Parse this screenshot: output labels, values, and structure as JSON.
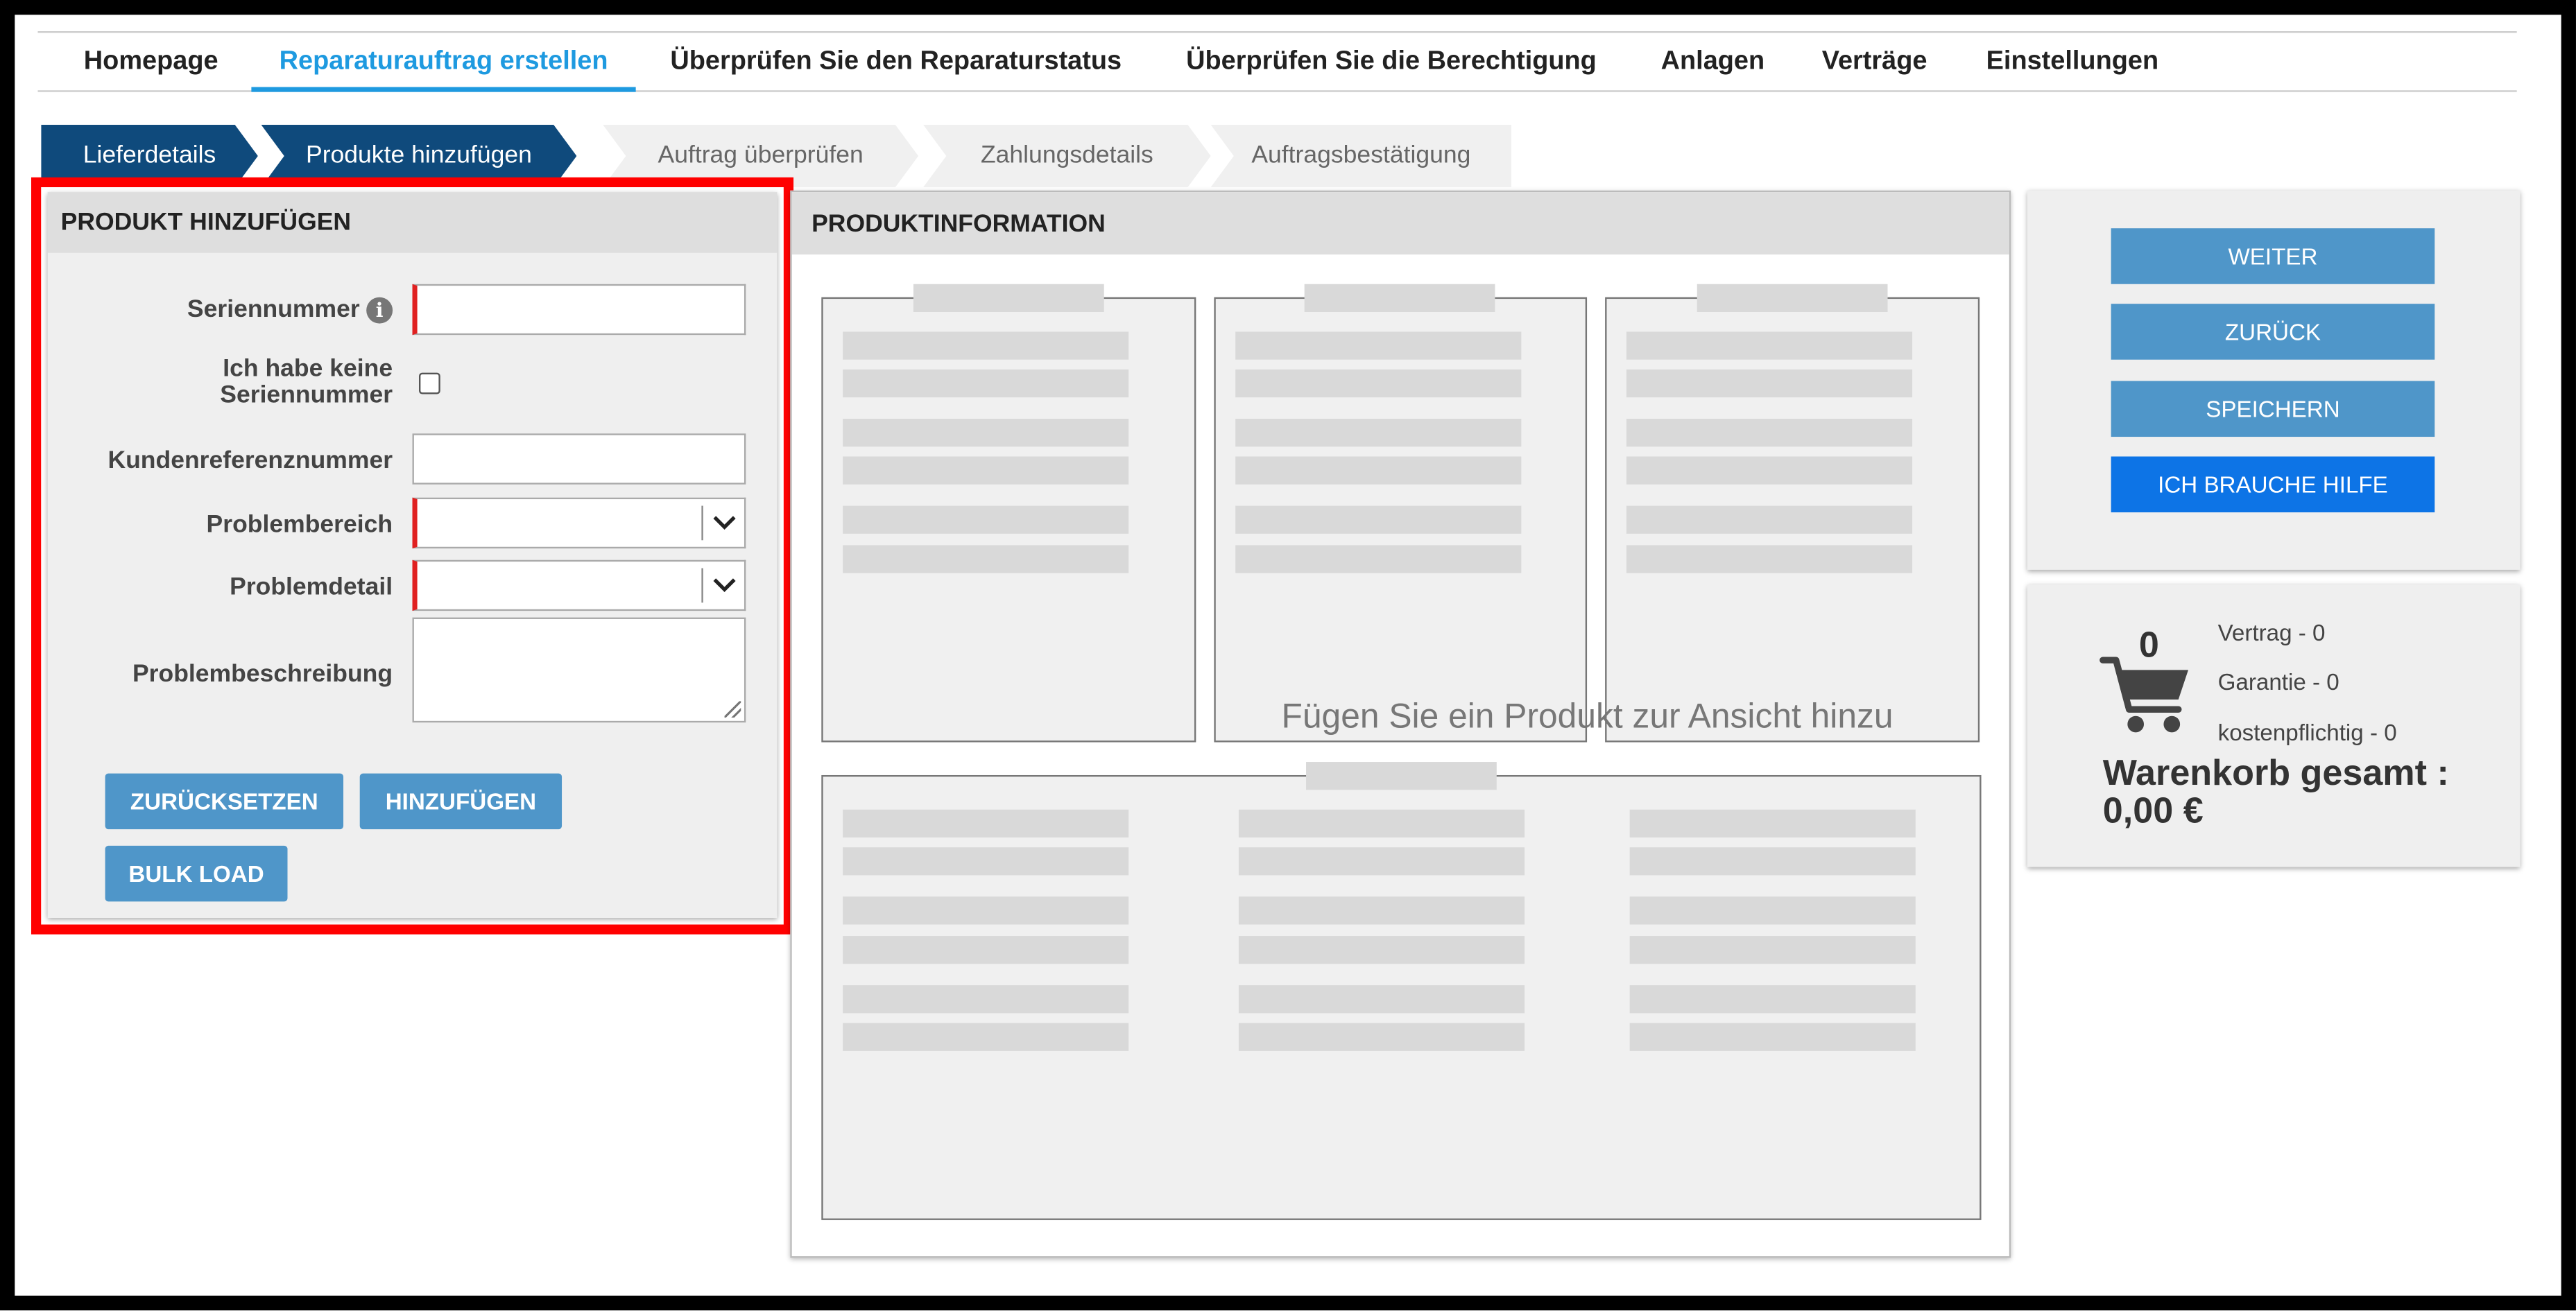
{
  "nav": {
    "items": [
      {
        "label": "Homepage",
        "active": false
      },
      {
        "label": "Reparaturauftrag erstellen",
        "active": true
      },
      {
        "label": "Überprüfen Sie den Reparaturstatus",
        "active": false
      },
      {
        "label": "Überprüfen Sie die Berechtigung",
        "active": false
      },
      {
        "label": "Anlagen",
        "active": false
      },
      {
        "label": "Verträge",
        "active": false
      },
      {
        "label": "Einstellungen",
        "active": false
      }
    ]
  },
  "steps": [
    {
      "label": "Lieferdetails",
      "state": "done"
    },
    {
      "label": "Produkte hinzufügen",
      "state": "current"
    },
    {
      "label": "Auftrag überprüfen",
      "state": "todo"
    },
    {
      "label": "Zahlungsdetails",
      "state": "todo"
    },
    {
      "label": "Auftragsbestätigung",
      "state": "todo"
    }
  ],
  "add_product": {
    "title": "PRODUKT HINZUFÜGEN",
    "serial_label": "Seriennummer",
    "serial_value": "",
    "no_serial_label_line1": "Ich habe keine",
    "no_serial_label_line2": "Seriennummer",
    "no_serial_checked": false,
    "customer_ref_label": "Kundenreferenznummer",
    "customer_ref_value": "",
    "problem_area_label": "Problembereich",
    "problem_area_value": "",
    "problem_detail_label": "Problemdetail",
    "problem_detail_value": "",
    "problem_desc_label": "Problembeschreibung",
    "problem_desc_value": "",
    "reset_button": "ZURÜCKSETZEN",
    "add_button": "HINZUFÜGEN",
    "bulk_button": "BULK LOAD"
  },
  "product_info": {
    "title": "PRODUKTINFORMATION",
    "empty_message": "Fügen Sie ein Produkt zur Ansicht hinzu"
  },
  "actions": {
    "next": "WEITER",
    "back": "ZURÜCK",
    "save": "SPEICHERN",
    "help": "ICH BRAUCHE HILFE"
  },
  "cart": {
    "count": "0",
    "contract": "Vertrag - 0",
    "warranty": "Garantie - 0",
    "paid": "kostenpflichtig - 0",
    "total_line1": "Warenkorb gesamt :",
    "total_line2": "0,00 €"
  },
  "icons": {
    "info": "info-icon",
    "dropdown": "chevron-down-icon",
    "cart": "shopping-cart-icon"
  },
  "colors": {
    "accent_blue": "#1e9ae0",
    "step_done": "#0f4a7c",
    "button_blue": "#4f96c9",
    "help_button": "#0d74e6",
    "required_marker": "#e02020",
    "highlight_frame": "#ff0000"
  }
}
